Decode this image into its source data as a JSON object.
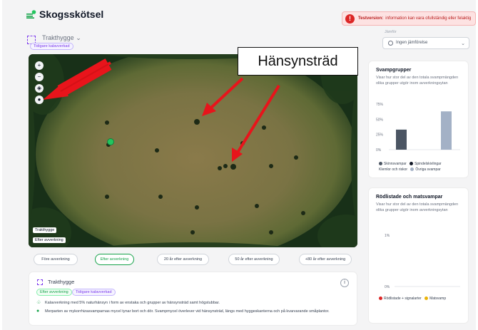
{
  "app": {
    "title": "Skogsskötsel",
    "step_number": "3",
    "test_banner_bold": "Testversion:",
    "test_banner_text": "information kan vara ofullständig eller felaktig"
  },
  "area": {
    "title": "Trakthygge",
    "chevron": "⌄",
    "pill": "Tidigare kalavverkad"
  },
  "compare": {
    "label": "Jämför",
    "value": "Ingen jämförelse"
  },
  "map": {
    "annotation": "Hänsynsträd",
    "label_top": "Trakthygge",
    "label_bottom": "Efter avverkning",
    "tools": [
      "zoom-in",
      "zoom-out",
      "layers",
      "color-palette"
    ],
    "arrow_color": "#e8141b"
  },
  "time_tabs": [
    {
      "label": "Före avverkning",
      "active": false
    },
    {
      "label": "Efter avverkning",
      "active": true
    },
    {
      "label": "20 år efter avverkning",
      "active": false
    },
    {
      "label": "50 år efter avverkning",
      "active": false
    },
    {
      "label": "+80 år efter avverkning",
      "active": false
    }
  ],
  "info": {
    "title": "Trakthygge",
    "pill_after": "Efter avverkning",
    "pill_prev": "Tidigare kalavverkad",
    "line1": "Kalavverkning med 5% naturhänsyn i form av enstaka och grupper av hänsynsträd samt högstubbar.",
    "line2": "Merparten av mykorrhizasvamparnas mycel tynar bort och dör. Svampmycel överlever vid hänsynsträd, längs med hyggeskanterna och på kvarvarande småplantor."
  },
  "svampgrupper": {
    "title": "Svampgrupper",
    "desc": "Visar hur stor del av den totala svampmängden olika grupper utgör inom avverkningsytan",
    "ticks": [
      "75%",
      "50%",
      "25%",
      "0%"
    ],
    "legend1a": "Skinnsvampar",
    "legend1b": "Spindelskivlingar",
    "legend2a": "Klemlor och riskor",
    "legend2b": "Övriga svampar",
    "colors": {
      "skinnsvampar": "#4b5563",
      "spindelskivlingar": "#111827",
      "ovriga": "#a3b1c6"
    }
  },
  "rodlistade": {
    "title": "Rödlistade och matsvampar",
    "desc": "Visar hur stor del av den totala svampmängden olika grupper utgör inom avverkningsytan",
    "tick_top": "1%",
    "tick_bottom": "0%",
    "legend_a": "Rödlistade + signalarter",
    "legend_b": "Matsvamp",
    "colors": {
      "rodlistade": "#dc2626",
      "matsvamp": "#eab308"
    }
  },
  "chart_data": [
    {
      "type": "bar",
      "title": "Svampgrupper",
      "categories": [
        "Skinnsvampar",
        "Spindelskivlingar",
        "Övriga svampar"
      ],
      "values": [
        33,
        0,
        63
      ],
      "ylim": [
        0,
        75
      ],
      "yticks": [
        "0%",
        "25%",
        "50%",
        "75%"
      ],
      "grid": false,
      "legend": "bottom"
    },
    {
      "type": "bar",
      "title": "Rödlistade och matsvampar",
      "categories": [
        "Rödlistade + signalarter",
        "Matsvamp"
      ],
      "values": [
        0,
        0
      ],
      "ylim": [
        0,
        1
      ],
      "yticks": [
        "0%",
        "1%"
      ],
      "grid": false,
      "legend": "bottom"
    }
  ]
}
